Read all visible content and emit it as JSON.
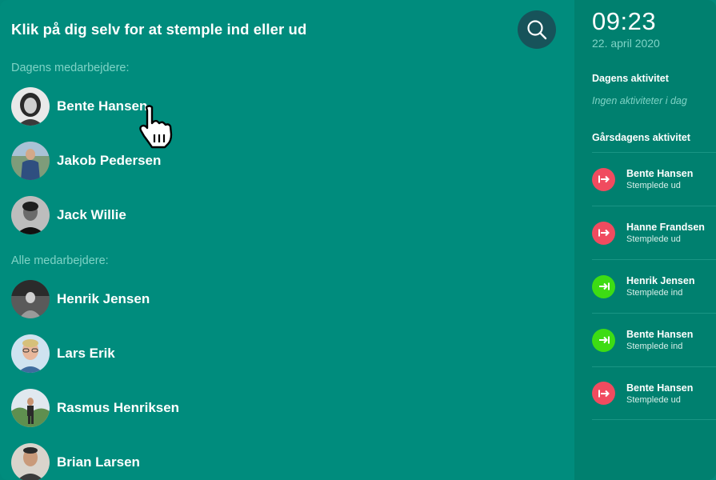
{
  "header": {
    "title": "Klik på dig selv for at stemple ind eller ud",
    "search_icon": "search-icon"
  },
  "main": {
    "today_label": "Dagens medarbejdere:",
    "all_label": "Alle medarbejdere:",
    "today_employees": [
      {
        "name": "Bente Hansen"
      },
      {
        "name": "Jakob Pedersen"
      },
      {
        "name": "Jack Willie"
      }
    ],
    "all_employees": [
      {
        "name": "Henrik Jensen"
      },
      {
        "name": "Lars Erik"
      },
      {
        "name": "Rasmus Henriksen"
      },
      {
        "name": "Brian Larsen"
      }
    ]
  },
  "sidebar": {
    "time": "09:23",
    "date": "22. april 2020",
    "today_activity_heading": "Dagens aktivitet",
    "today_activity_empty": "Ingen aktiviteter i dag",
    "yesterday_activity_heading": "Gårsdagens aktivitet",
    "activities": [
      {
        "name": "Bente Hansen",
        "status": "Stemplede ud",
        "type": "out"
      },
      {
        "name": "Hanne Frandsen",
        "status": "Stemplede ud",
        "type": "out"
      },
      {
        "name": "Henrik Jensen",
        "status": "Stemplede ind",
        "type": "in"
      },
      {
        "name": "Bente Hansen",
        "status": "Stemplede ind",
        "type": "in"
      },
      {
        "name": "Bente Hansen",
        "status": "Stemplede ud",
        "type": "out"
      }
    ]
  },
  "colors": {
    "background": "#008c7d",
    "sidebar": "#00806f",
    "search_button": "#17535a",
    "muted_text": "#7fd3c6",
    "clock_out": "#f04b5f",
    "clock_in": "#3ddc14"
  }
}
